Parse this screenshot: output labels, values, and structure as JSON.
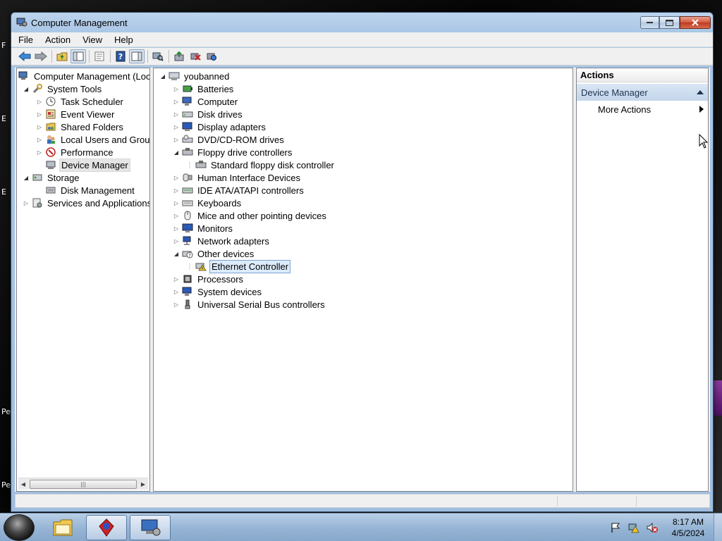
{
  "window": {
    "title": "Computer Management"
  },
  "desktop": {
    "labels": [
      "F",
      "E",
      "E",
      "Pe",
      "Pe"
    ]
  },
  "menubar": [
    "File",
    "Action",
    "View",
    "Help"
  ],
  "tree": {
    "root": "Computer Management (Local",
    "system_tools": "System Tools",
    "task_scheduler": "Task Scheduler",
    "event_viewer": "Event Viewer",
    "shared_folders": "Shared Folders",
    "local_users": "Local Users and Groups",
    "performance": "Performance",
    "device_manager": "Device Manager",
    "storage": "Storage",
    "disk_management": "Disk Management",
    "services": "Services and Applications"
  },
  "devices": {
    "computer_name": "youbanned",
    "items": [
      {
        "label": "Batteries",
        "icon": "battery-icon"
      },
      {
        "label": "Computer",
        "icon": "computer-icon"
      },
      {
        "label": "Disk drives",
        "icon": "disk-drive-icon"
      },
      {
        "label": "Display adapters",
        "icon": "display-adapter-icon"
      },
      {
        "label": "DVD/CD-ROM drives",
        "icon": "dvd-drive-icon"
      },
      {
        "label": "Floppy drive controllers",
        "icon": "floppy-controller-icon"
      },
      {
        "label": "Standard floppy disk controller",
        "icon": "floppy-controller-icon"
      },
      {
        "label": "Human Interface Devices",
        "icon": "hid-icon"
      },
      {
        "label": "IDE ATA/ATAPI controllers",
        "icon": "ide-controller-icon"
      },
      {
        "label": "Keyboards",
        "icon": "keyboard-icon"
      },
      {
        "label": "Mice and other pointing devices",
        "icon": "mouse-icon"
      },
      {
        "label": "Monitors",
        "icon": "monitor-icon"
      },
      {
        "label": "Network adapters",
        "icon": "network-adapter-icon"
      },
      {
        "label": "Other devices",
        "icon": "unknown-device-icon"
      },
      {
        "label": "Ethernet Controller",
        "icon": "warning-device-icon"
      },
      {
        "label": "Processors",
        "icon": "processor-icon"
      },
      {
        "label": "System devices",
        "icon": "system-device-icon"
      },
      {
        "label": "Universal Serial Bus controllers",
        "icon": "usb-icon"
      }
    ]
  },
  "actions": {
    "header": "Actions",
    "section": "Device Manager",
    "more": "More Actions"
  },
  "taskbar": {
    "time": "8:17 AM",
    "date": "4/5/2024"
  }
}
